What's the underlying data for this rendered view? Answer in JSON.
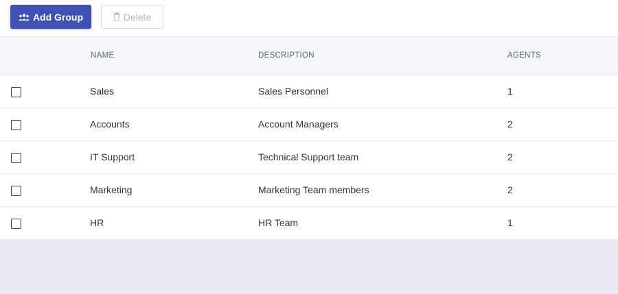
{
  "toolbar": {
    "add_group_label": "Add Group",
    "add_group_icon": "group-icon",
    "delete_label": "Delete",
    "delete_icon": "trash-icon",
    "accent_color": "#3f51b5"
  },
  "table": {
    "columns": [
      "NAME",
      "DESCRIPTION",
      "AGENTS"
    ],
    "rows": [
      {
        "name": "Sales",
        "description": "Sales Personnel",
        "agents": "1"
      },
      {
        "name": "Accounts",
        "description": "Account Managers",
        "agents": "2"
      },
      {
        "name": "IT Support",
        "description": "Technical Support team",
        "agents": "2"
      },
      {
        "name": "Marketing",
        "description": "Marketing Team members",
        "agents": "2"
      },
      {
        "name": "HR",
        "description": "HR Team",
        "agents": "1"
      }
    ]
  }
}
